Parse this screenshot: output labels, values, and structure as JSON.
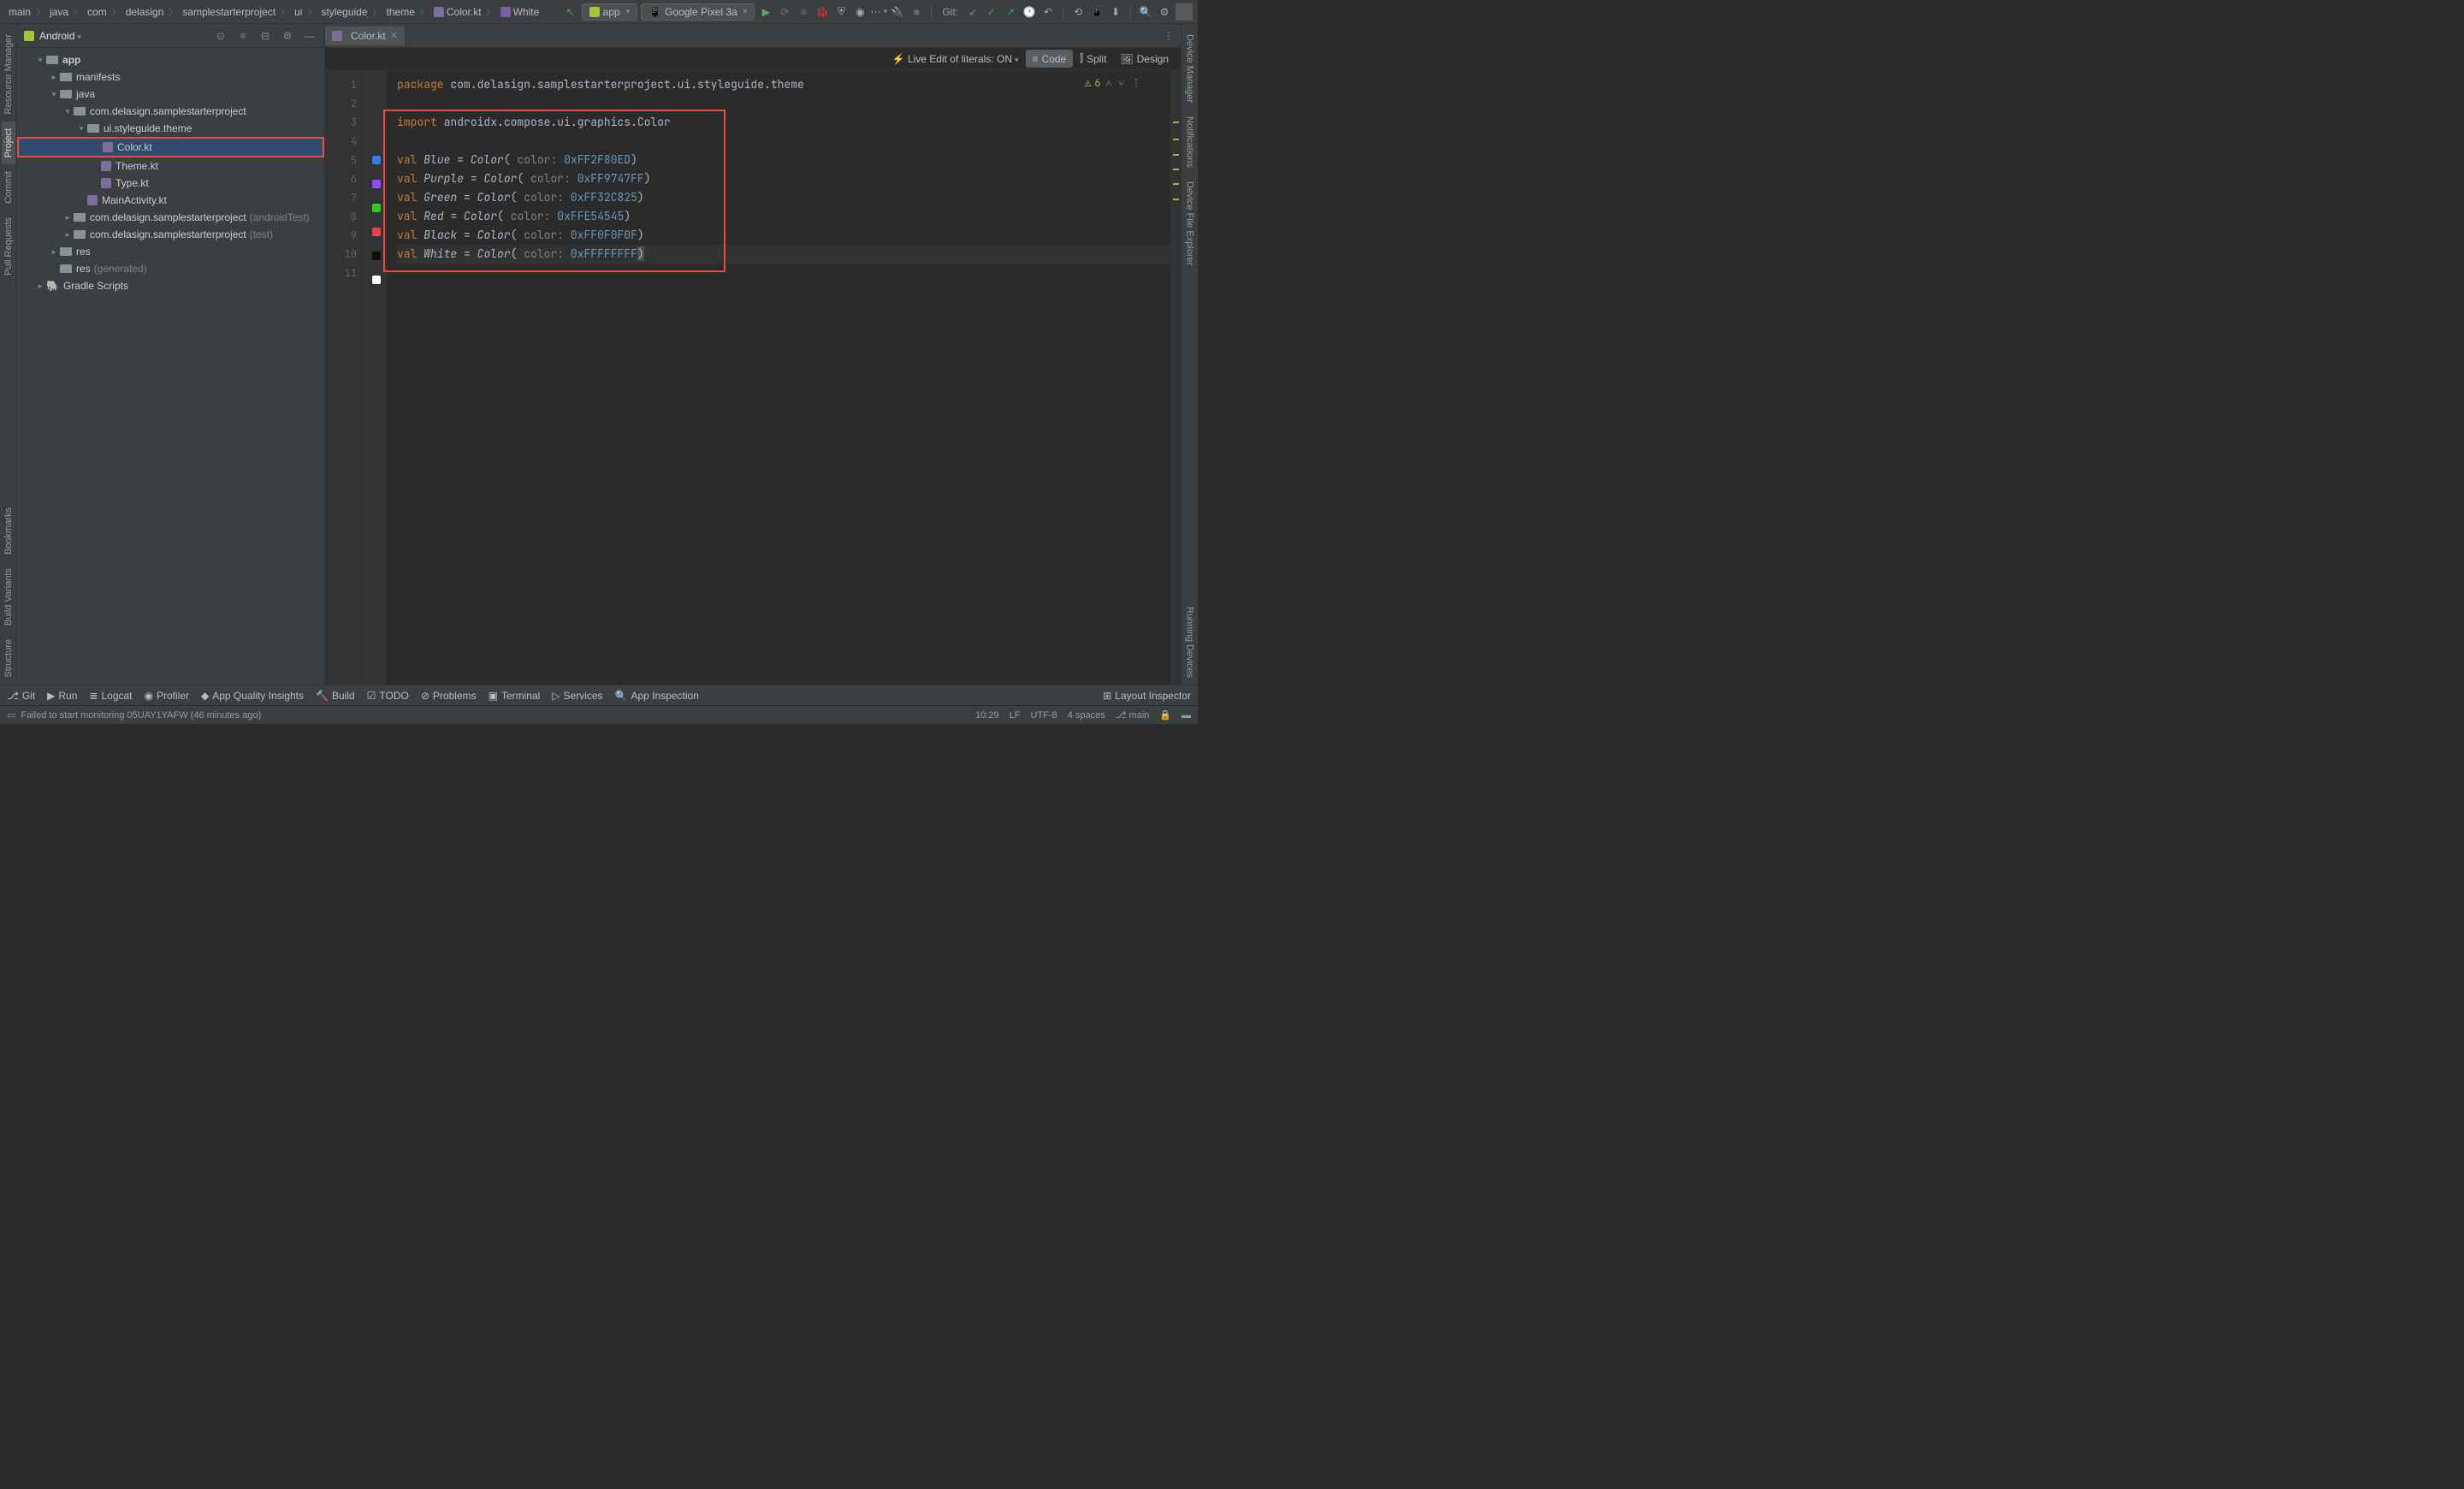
{
  "breadcrumb": [
    "main",
    "java",
    "com",
    "delasign",
    "samplestarterproject",
    "ui",
    "styleguide",
    "theme",
    "Color.kt",
    "White"
  ],
  "run_config": {
    "label": "app"
  },
  "device": {
    "label": "Google Pixel 3a"
  },
  "git_label": "Git:",
  "project": {
    "view_label": "Android",
    "tree": {
      "app": "app",
      "manifests": "manifests",
      "java": "java",
      "pkg1": "com.delasign.samplestarterproject",
      "pkg2": "ui.styleguide.theme",
      "color": "Color.kt",
      "theme": "Theme.kt",
      "type": "Type.kt",
      "mainactivity": "MainActivity.kt",
      "pkg_androidtest": "com.delasign.samplestarterproject",
      "pkg_androidtest_suffix": "(androidTest)",
      "pkg_test": "com.delasign.samplestarterproject",
      "pkg_test_suffix": "(test)",
      "res": "res",
      "res_gen": "res",
      "res_gen_suffix": "(generated)",
      "gradle": "Gradle Scripts"
    }
  },
  "left_tabs": {
    "resource_manager": "Resource Manager",
    "project": "Project",
    "commit": "Commit",
    "pull_requests": "Pull Requests",
    "bookmarks": "Bookmarks",
    "build_variants": "Build Variants",
    "structure": "Structure"
  },
  "right_tabs": {
    "device_manager": "Device Manager",
    "notifications": "Notifications",
    "device_file_explorer": "Device File Explorer",
    "running_devices": "Running Devices"
  },
  "editor": {
    "tab": "Color.kt",
    "live_edit": "Live Edit of literals: ON",
    "views": {
      "code": "Code",
      "split": "Split",
      "design": "Design"
    },
    "warning_count": "6",
    "code_lines": [
      {
        "n": 1,
        "html": "<span class='kw'>package</span> <span class='pkg'>com.delasign.samplestarterproject.ui.styleguide.theme</span>"
      },
      {
        "n": 2,
        "html": ""
      },
      {
        "n": 3,
        "html": "<span class='kw'>import</span> <span class='pkg'>androidx.compose.ui.graphics.Color</span>"
      },
      {
        "n": 4,
        "html": ""
      },
      {
        "n": 5,
        "swatch": "#2F80ED",
        "html": "<span class='kw'>val</span> <span class='type'>Blue</span> = <span class='fn'>Color</span><span class='paren'>(</span> <span class='param'>color:</span> <span class='num'>0xFF2F80ED</span><span class='paren'>)</span>"
      },
      {
        "n": 6,
        "swatch": "#9747FF",
        "html": "<span class='kw'>val</span> <span class='type'>Purple</span> = <span class='fn'>Color</span><span class='paren'>(</span> <span class='param'>color:</span> <span class='num'>0xFF9747FF</span><span class='paren'>)</span>"
      },
      {
        "n": 7,
        "swatch": "#32C825",
        "html": "<span class='kw'>val</span> <span class='type'>Green</span> = <span class='fn'>Color</span><span class='paren'>(</span> <span class='param'>color:</span> <span class='num'>0xFF32C825</span><span class='paren'>)</span>"
      },
      {
        "n": 8,
        "swatch": "#E54545",
        "html": "<span class='kw'>val</span> <span class='type'>Red</span> = <span class='fn'>Color</span><span class='paren'>(</span> <span class='param'>color:</span> <span class='num'>0xFFE54545</span><span class='paren'>)</span>"
      },
      {
        "n": 9,
        "swatch": "#0F0F0F",
        "html": "<span class='kw'>val</span> <span class='type'>Black</span> = <span class='fn'>Color</span><span class='paren'>(</span> <span class='param'>color:</span> <span class='num'>0xFF0F0F0F</span><span class='paren'>)</span>"
      },
      {
        "n": 10,
        "swatch": "#FFFFFF",
        "html": "<span class='kw'>val</span> <span class='type'>White</span> = <span class='fn'>Color</span><span class='paren'>(</span> <span class='param'>color:</span> <span class='num'>0xFFFFFFFF</span><span class='paren' style='background:#4e5254'>)</span>"
      },
      {
        "n": 11,
        "html": ""
      }
    ]
  },
  "bottom_bar": {
    "git": "Git",
    "run": "Run",
    "logcat": "Logcat",
    "profiler": "Profiler",
    "quality": "App Quality Insights",
    "build": "Build",
    "todo": "TODO",
    "problems": "Problems",
    "terminal": "Terminal",
    "services": "Services",
    "inspection": "App Inspection",
    "layout_inspector": "Layout Inspector"
  },
  "status": {
    "message": "Failed to start monitoring 05UAY1YAFW (46 minutes ago)",
    "cursor": "10:29",
    "line_sep": "LF",
    "encoding": "UTF-8",
    "indent": "4 spaces",
    "branch": "main"
  }
}
